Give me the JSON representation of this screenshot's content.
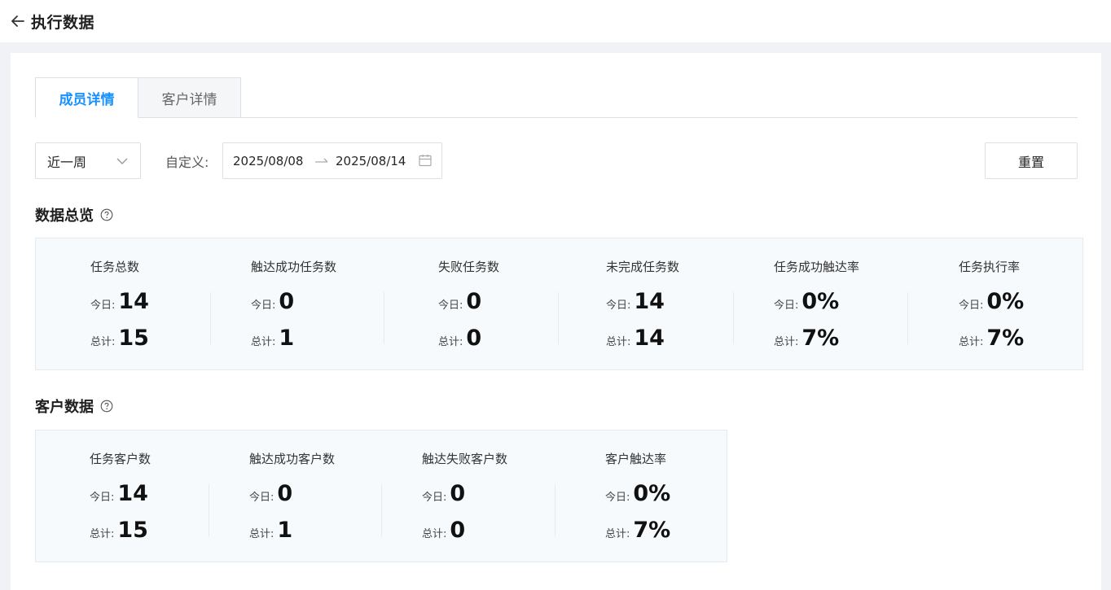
{
  "header": {
    "title": "执行数据",
    "back_icon": "arrow-left-icon"
  },
  "tabs": [
    {
      "label": "成员详情",
      "active": true
    },
    {
      "label": "客户详情",
      "active": false
    }
  ],
  "filters": {
    "period": {
      "value": "近一周",
      "icon": "chevron-down-icon"
    },
    "custom_label": "自定义:",
    "date_start": "2025/08/08",
    "date_end": "2025/08/14",
    "calendar_icon": "calendar-icon",
    "reset_label": "重置"
  },
  "overview": {
    "title": "数据总览",
    "help_icon": "question-circle-icon",
    "stats": [
      {
        "name": "任务总数",
        "today_label": "今日:",
        "today": "14",
        "total_label": "总计:",
        "total": "15"
      },
      {
        "name": "触达成功任务数",
        "today_label": "今日:",
        "today": "0",
        "total_label": "总计:",
        "total": "1"
      },
      {
        "name": "失败任务数",
        "today_label": "今日:",
        "today": "0",
        "total_label": "总计:",
        "total": "0"
      },
      {
        "name": "未完成任务数",
        "today_label": "今日:",
        "today": "14",
        "total_label": "总计:",
        "total": "14"
      },
      {
        "name": "任务成功触达率",
        "today_label": "今日:",
        "today": "0%",
        "total_label": "总计:",
        "total": "7%"
      },
      {
        "name": "任务执行率",
        "today_label": "今日:",
        "today": "0%",
        "total_label": "总计:",
        "total": "7%"
      }
    ]
  },
  "customers": {
    "title": "客户数据",
    "help_icon": "question-circle-icon",
    "stats": [
      {
        "name": "任务客户数",
        "today_label": "今日:",
        "today": "14",
        "total_label": "总计:",
        "total": "15"
      },
      {
        "name": "触达成功客户数",
        "today_label": "今日:",
        "today": "0",
        "total_label": "总计:",
        "total": "1"
      },
      {
        "name": "触达失败客户数",
        "today_label": "今日:",
        "today": "0",
        "total_label": "总计:",
        "total": "0"
      },
      {
        "name": "客户触达率",
        "today_label": "今日:",
        "today": "0%",
        "total_label": "总计:",
        "total": "7%"
      }
    ]
  }
}
